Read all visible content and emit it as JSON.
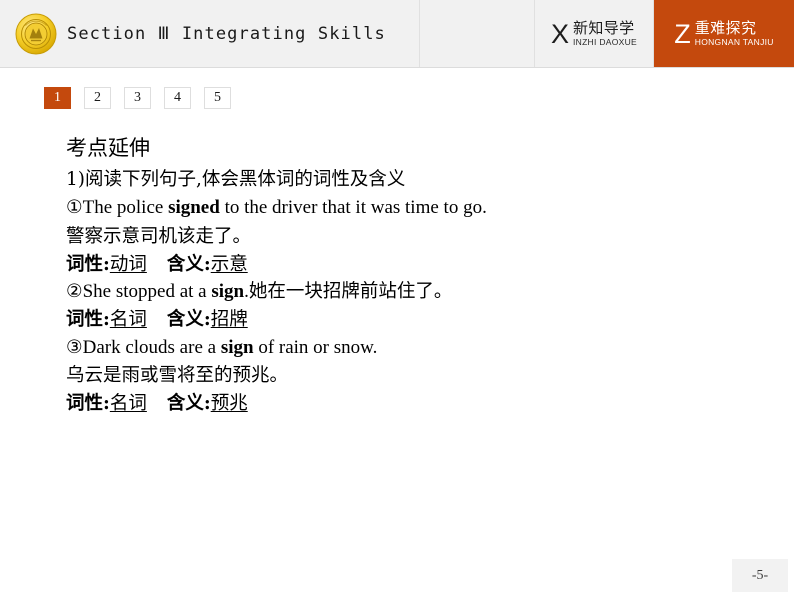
{
  "header": {
    "logo_icon": "gold-medallion-emblem-icon",
    "title": "Section Ⅲ  Integrating Skills",
    "nav_tabs": [
      {
        "initial": "X",
        "cn": "新知导学",
        "pinyin": "INZHI DAOXUE",
        "active": false
      },
      {
        "initial": "Z",
        "cn": "重难探究",
        "pinyin": "HONGNAN TANJIU",
        "active": true
      }
    ]
  },
  "number_tabs": [
    {
      "label": "1",
      "active": true
    },
    {
      "label": "2",
      "active": false
    },
    {
      "label": "3",
      "active": false
    },
    {
      "label": "4",
      "active": false
    },
    {
      "label": "5",
      "active": false
    }
  ],
  "content": {
    "heading": "考点延伸",
    "instruction": "1)阅读下列句子,体会黑体词的词性及含义",
    "items": [
      {
        "marker": "①",
        "en_before": "The police ",
        "en_bold": "signed",
        "en_after": " to the driver that it was time to go.",
        "cn_translation": "警察示意司机该走了。",
        "cn_inline": "",
        "pos_label": "词性:",
        "pos_answer": "动词",
        "meaning_label": "含义:",
        "meaning_answer": "示意"
      },
      {
        "marker": "②",
        "en_before": "She stopped at a ",
        "en_bold": "sign",
        "en_after": ".",
        "cn_translation": "",
        "cn_inline": "她在一块招牌前站住了。",
        "pos_label": "词性:",
        "pos_answer": "名词",
        "meaning_label": "含义:",
        "meaning_answer": "招牌"
      },
      {
        "marker": "③",
        "en_before": "Dark clouds are a ",
        "en_bold": "sign",
        "en_after": " of rain or snow.",
        "cn_translation": "乌云是雨或雪将至的预兆。",
        "cn_inline": "",
        "pos_label": "词性:",
        "pos_answer": "名词",
        "meaning_label": "含义:",
        "meaning_answer": "预兆"
      }
    ]
  },
  "footer": {
    "page_number": "-5-"
  },
  "colors": {
    "accent_orange": "#c4490d",
    "header_bg": "#f1f1f1",
    "page_bg": "#ffffff",
    "text": "#000000"
  }
}
